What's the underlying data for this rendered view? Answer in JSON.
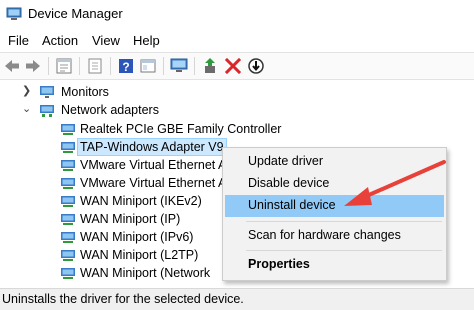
{
  "window": {
    "title": "Device Manager"
  },
  "menu": [
    "File",
    "Action",
    "View",
    "Help"
  ],
  "toolbar_icons": [
    "back-icon",
    "forward-icon",
    "properties-icon",
    "update-driver-icon",
    "help-icon",
    "view-icon",
    "scan-icon",
    "enable-device-icon",
    "uninstall-icon",
    "disable-icon"
  ],
  "tree": {
    "monitors": "Monitors",
    "network_adapters": "Network adapters",
    "adapters": [
      "Realtek PCIe GBE Family Controller",
      "TAP-Windows Adapter V9",
      "VMware Virtual Ethernet A",
      "VMware Virtual Ethernet A",
      "WAN Miniport (IKEv2)",
      "WAN Miniport (IP)",
      "WAN Miniport (IPv6)",
      "WAN Miniport (L2TP)",
      "WAN Miniport (Network"
    ]
  },
  "context_menu": {
    "update_driver": "Update driver",
    "disable_device": "Disable device",
    "uninstall_device": "Uninstall device",
    "scan": "Scan for hardware changes",
    "properties": "Properties"
  },
  "status": "Uninstalls the driver for the selected device.",
  "colors": {
    "highlight": "#91c9f7",
    "selection": "#cce8ff",
    "arrow": "#e8413a",
    "uninstall_red": "#d9262b"
  }
}
